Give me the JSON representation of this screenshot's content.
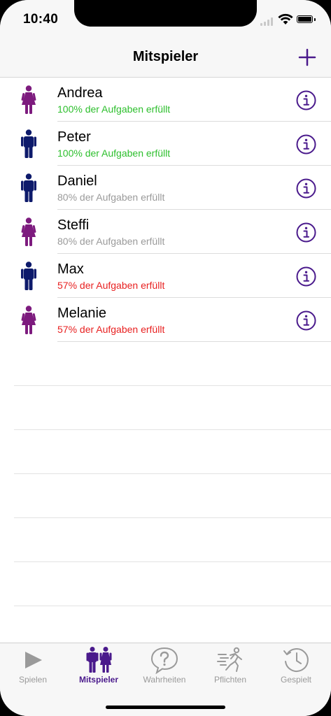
{
  "status_bar": {
    "time": "10:40"
  },
  "nav": {
    "title": "Mitspieler",
    "add_icon": "plus-icon"
  },
  "colors": {
    "accent": "#4a1a8c",
    "female": "#7d1b7e",
    "male": "#0d1a6b",
    "status_green": "#2dbf2d",
    "status_gray": "#9a9a9a",
    "status_red": "#e82020"
  },
  "players": [
    {
      "name": "Andrea",
      "status": "100% der Aufgaben erfüllt",
      "gender": "female",
      "status_color": "#2dbf2d"
    },
    {
      "name": "Peter",
      "status": "100% der Aufgaben erfüllt",
      "gender": "male",
      "status_color": "#2dbf2d"
    },
    {
      "name": "Daniel",
      "status": "80% der Aufgaben erfüllt",
      "gender": "male",
      "status_color": "#9a9a9a"
    },
    {
      "name": "Steffi",
      "status": "80% der Aufgaben erfüllt",
      "gender": "female",
      "status_color": "#9a9a9a"
    },
    {
      "name": "Max",
      "status": "57% der Aufgaben erfüllt",
      "gender": "male",
      "status_color": "#e82020"
    },
    {
      "name": "Melanie",
      "status": "57% der Aufgaben erfüllt",
      "gender": "female",
      "status_color": "#e82020"
    }
  ],
  "tabs": [
    {
      "label": "Spielen",
      "icon": "play-icon",
      "active": false
    },
    {
      "label": "Mitspieler",
      "icon": "players-icon",
      "active": true
    },
    {
      "label": "Wahrheiten",
      "icon": "question-bubble-icon",
      "active": false
    },
    {
      "label": "Pflichten",
      "icon": "running-person-icon",
      "active": false
    },
    {
      "label": "Gespielt",
      "icon": "history-clock-icon",
      "active": false
    }
  ]
}
